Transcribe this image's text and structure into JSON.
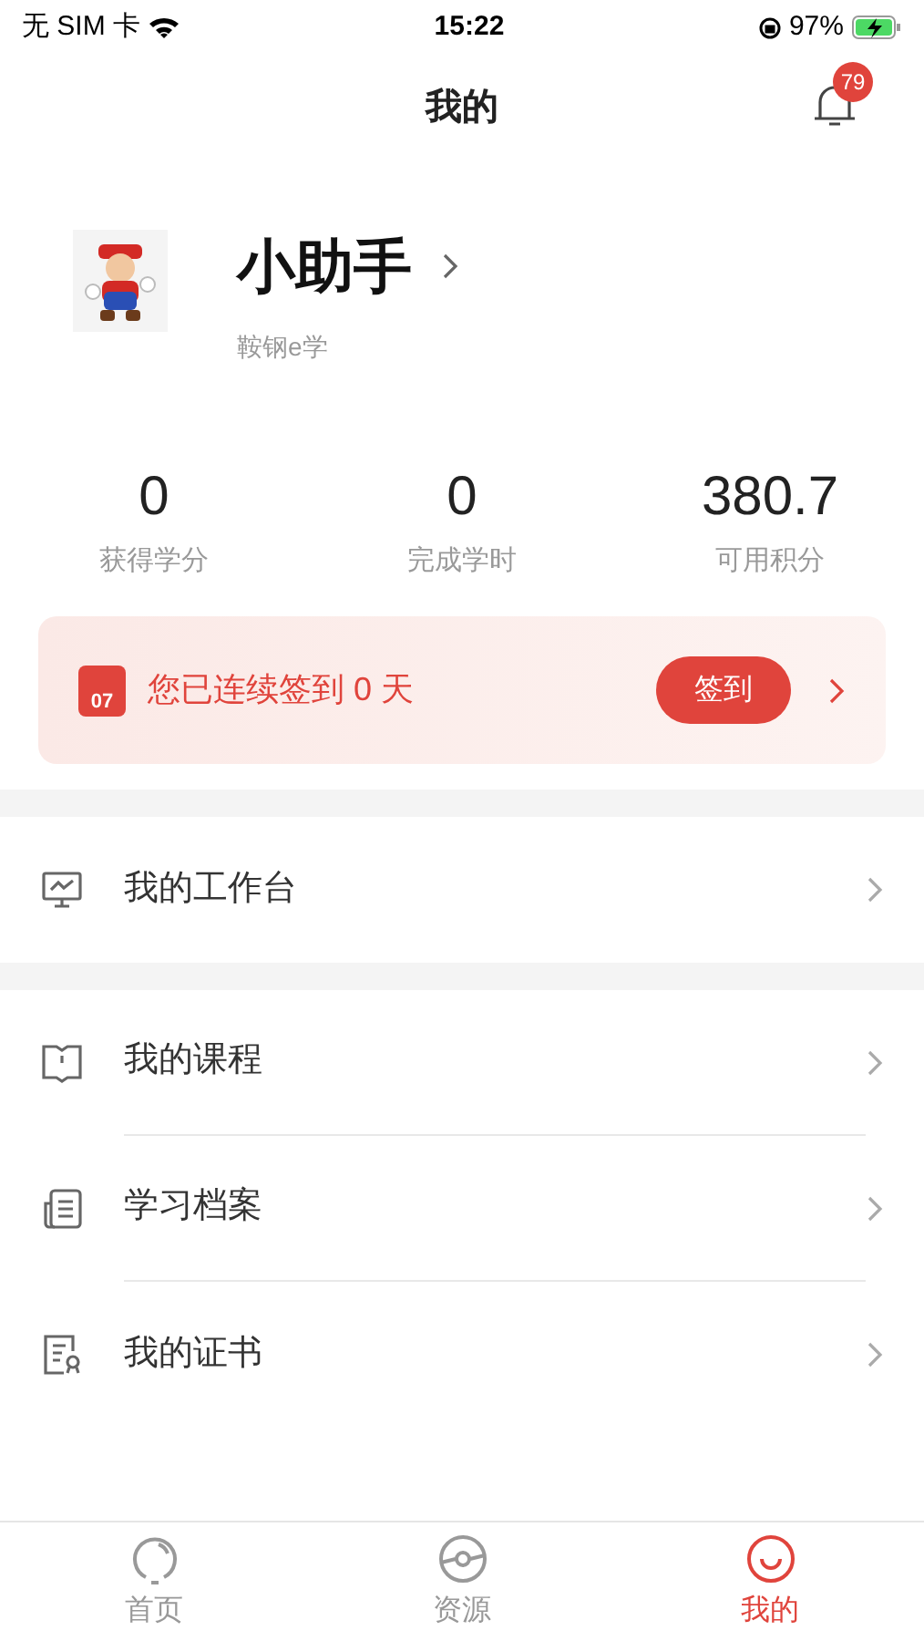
{
  "status_bar": {
    "carrier": "无 SIM 卡",
    "time": "15:22",
    "battery": "97%"
  },
  "header": {
    "title": "我的",
    "badge": "79"
  },
  "profile": {
    "name": "小助手",
    "org": "鞍钢e学"
  },
  "stats": [
    {
      "value": "0",
      "label": "获得学分"
    },
    {
      "value": "0",
      "label": "完成学时"
    },
    {
      "value": "380.7",
      "label": "可用积分"
    }
  ],
  "checkin": {
    "date": "07",
    "text": "您已连续签到 0 天",
    "button": "签到"
  },
  "menu_groups": [
    [
      {
        "kind": "monitor",
        "label": "我的工作台"
      }
    ],
    [
      {
        "kind": "book",
        "label": "我的课程"
      },
      {
        "kind": "file",
        "label": "学习档案"
      },
      {
        "kind": "certificate",
        "label": "我的证书"
      }
    ]
  ],
  "tabs": [
    {
      "kind": "home",
      "label": "首页",
      "selected": false
    },
    {
      "kind": "resource",
      "label": "资源",
      "selected": false
    },
    {
      "kind": "me",
      "label": "我的",
      "selected": true
    }
  ]
}
